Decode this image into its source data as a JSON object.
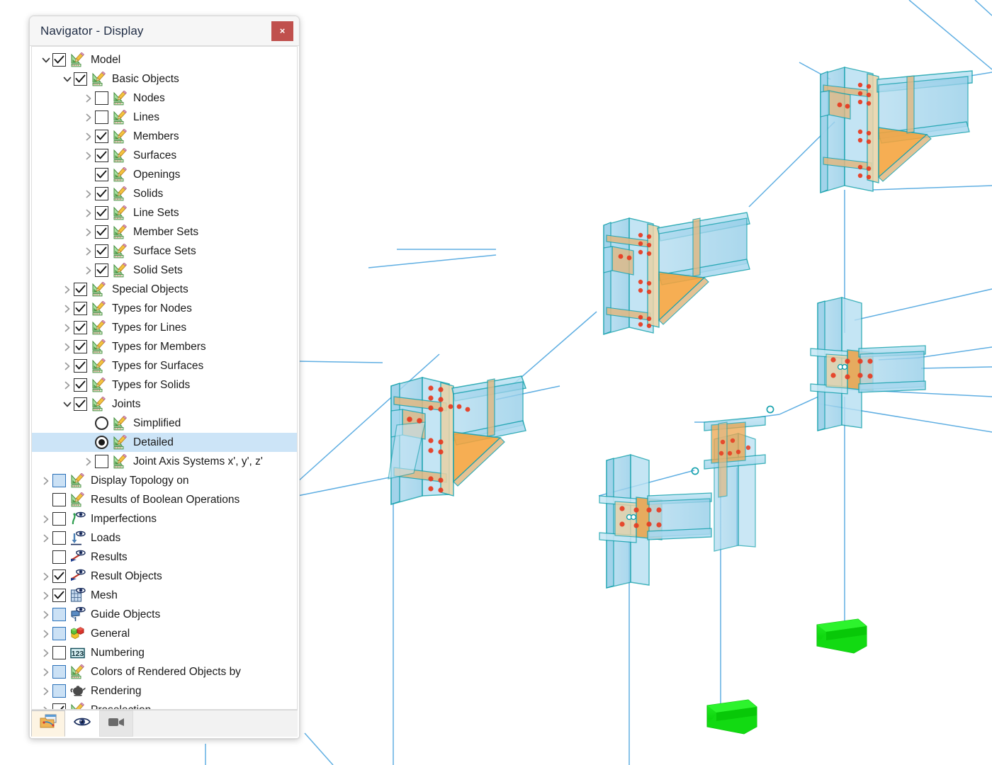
{
  "window": {
    "title": "Navigator - Display",
    "close_label": "×",
    "close_icon": "close-icon",
    "accent_close_color": "#c0504d",
    "selection_color": "#cce4f7"
  },
  "tree": {
    "items": [
      {
        "label": "Model",
        "depth": 0,
        "chev": "down",
        "control": "checkbox",
        "state": "checked",
        "icon": "edit-model-icon"
      },
      {
        "label": "Basic Objects",
        "depth": 1,
        "chev": "down",
        "control": "checkbox",
        "state": "checked",
        "icon": "edit-model-icon"
      },
      {
        "label": "Nodes",
        "depth": 2,
        "chev": "right",
        "control": "checkbox",
        "state": "unchecked",
        "icon": "edit-model-icon"
      },
      {
        "label": "Lines",
        "depth": 2,
        "chev": "right",
        "control": "checkbox",
        "state": "unchecked",
        "icon": "edit-model-icon"
      },
      {
        "label": "Members",
        "depth": 2,
        "chev": "right",
        "control": "checkbox",
        "state": "checked",
        "icon": "edit-model-icon"
      },
      {
        "label": "Surfaces",
        "depth": 2,
        "chev": "right",
        "control": "checkbox",
        "state": "checked",
        "icon": "edit-model-icon"
      },
      {
        "label": "Openings",
        "depth": 2,
        "chev": "none",
        "control": "checkbox",
        "state": "checked",
        "icon": "edit-model-icon"
      },
      {
        "label": "Solids",
        "depth": 2,
        "chev": "right",
        "control": "checkbox",
        "state": "checked",
        "icon": "edit-model-icon"
      },
      {
        "label": "Line Sets",
        "depth": 2,
        "chev": "right",
        "control": "checkbox",
        "state": "checked",
        "icon": "edit-model-icon"
      },
      {
        "label": "Member Sets",
        "depth": 2,
        "chev": "right",
        "control": "checkbox",
        "state": "checked",
        "icon": "edit-model-icon"
      },
      {
        "label": "Surface Sets",
        "depth": 2,
        "chev": "right",
        "control": "checkbox",
        "state": "checked",
        "icon": "edit-model-icon"
      },
      {
        "label": "Solid Sets",
        "depth": 2,
        "chev": "right",
        "control": "checkbox",
        "state": "checked",
        "icon": "edit-model-icon"
      },
      {
        "label": "Special Objects",
        "depth": 1,
        "chev": "right",
        "control": "checkbox",
        "state": "checked",
        "icon": "edit-model-icon"
      },
      {
        "label": "Types for Nodes",
        "depth": 1,
        "chev": "right",
        "control": "checkbox",
        "state": "checked",
        "icon": "edit-model-icon"
      },
      {
        "label": "Types for Lines",
        "depth": 1,
        "chev": "right",
        "control": "checkbox",
        "state": "checked",
        "icon": "edit-model-icon"
      },
      {
        "label": "Types for Members",
        "depth": 1,
        "chev": "right",
        "control": "checkbox",
        "state": "checked",
        "icon": "edit-model-icon"
      },
      {
        "label": "Types for Surfaces",
        "depth": 1,
        "chev": "right",
        "control": "checkbox",
        "state": "checked",
        "icon": "edit-model-icon"
      },
      {
        "label": "Types for Solids",
        "depth": 1,
        "chev": "right",
        "control": "checkbox",
        "state": "checked",
        "icon": "edit-model-icon"
      },
      {
        "label": "Joints",
        "depth": 1,
        "chev": "down",
        "control": "checkbox",
        "state": "checked",
        "icon": "edit-model-icon"
      },
      {
        "label": "Simplified",
        "depth": 2,
        "chev": "none",
        "control": "radio",
        "state": "off",
        "icon": "edit-model-icon"
      },
      {
        "label": "Detailed",
        "depth": 2,
        "chev": "none",
        "control": "radio",
        "state": "on",
        "icon": "edit-model-icon",
        "selected": true
      },
      {
        "label": "Joint Axis Systems x', y', z'",
        "depth": 2,
        "chev": "right",
        "control": "checkbox",
        "state": "unchecked",
        "icon": "edit-model-icon"
      },
      {
        "label": "Display Topology on",
        "depth": 0,
        "chev": "right",
        "control": "checkbox",
        "state": "partial",
        "icon": "edit-model-icon"
      },
      {
        "label": "Results of Boolean Operations",
        "depth": 0,
        "chev": "none",
        "control": "checkbox",
        "state": "unchecked",
        "icon": "edit-model-icon"
      },
      {
        "label": "Imperfections",
        "depth": 0,
        "chev": "right",
        "control": "checkbox",
        "state": "unchecked",
        "icon": "imperfections-eye-icon"
      },
      {
        "label": "Loads",
        "depth": 0,
        "chev": "right",
        "control": "checkbox",
        "state": "unchecked",
        "icon": "loads-eye-icon"
      },
      {
        "label": "Results",
        "depth": 0,
        "chev": "none",
        "control": "checkbox",
        "state": "unchecked",
        "icon": "results-eye-icon"
      },
      {
        "label": "Result Objects",
        "depth": 0,
        "chev": "right",
        "control": "checkbox",
        "state": "checked",
        "icon": "results-eye-icon"
      },
      {
        "label": "Mesh",
        "depth": 0,
        "chev": "right",
        "control": "checkbox",
        "state": "checked",
        "icon": "mesh-grid-eye-icon"
      },
      {
        "label": "Guide Objects",
        "depth": 0,
        "chev": "right",
        "control": "checkbox",
        "state": "partial",
        "icon": "guide-objects-eye-icon"
      },
      {
        "label": "General",
        "depth": 0,
        "chev": "right",
        "control": "checkbox",
        "state": "partial",
        "icon": "colored-cubes-icon"
      },
      {
        "label": "Numbering",
        "depth": 0,
        "chev": "right",
        "control": "checkbox",
        "state": "unchecked",
        "icon": "numbering-123-icon"
      },
      {
        "label": "Colors of Rendered Objects by",
        "depth": 0,
        "chev": "right",
        "control": "checkbox",
        "state": "partial",
        "icon": "edit-model-icon"
      },
      {
        "label": "Rendering",
        "depth": 0,
        "chev": "right",
        "control": "checkbox",
        "state": "partial",
        "icon": "teapot-icon"
      },
      {
        "label": "Preselection",
        "depth": 0,
        "chev": "right",
        "control": "checkbox",
        "state": "checked",
        "icon": "edit-model-icon"
      }
    ]
  },
  "toolbar": {
    "buttons": [
      {
        "name": "display-navigator-tab",
        "icon": "folder-display-icon",
        "state": "active"
      },
      {
        "name": "views-navigator-tab",
        "icon": "eye-icon",
        "state": "lit"
      },
      {
        "name": "camera-navigator-tab",
        "icon": "video-camera-icon",
        "state": "shaded"
      }
    ]
  },
  "viewport": {
    "description": "3D rendered steel frame model with detailed bolted joints",
    "colors": {
      "member_fill": "#a8d8ef",
      "member_edge": "#13a0ac",
      "haunch_fill": "#f5a33c",
      "plate_fill": "#e0b882",
      "bolt_color": "#e8391f",
      "wireframe_line": "#52a8e0",
      "support_green": "#19e019"
    },
    "joints": [
      {
        "name": "joint-top-right",
        "type": "haunched-moment-connection"
      },
      {
        "name": "joint-middle",
        "type": "haunched-moment-connection"
      },
      {
        "name": "joint-left",
        "type": "haunched-moment-connection"
      },
      {
        "name": "joint-right-cross",
        "type": "fin-plate-connection"
      },
      {
        "name": "joint-lower-left",
        "type": "fin-plate-connection"
      },
      {
        "name": "joint-lower-right",
        "type": "splice-connection"
      }
    ],
    "supports": [
      {
        "name": "support-left",
        "kind": "nodal-support"
      },
      {
        "name": "support-right",
        "kind": "nodal-support"
      }
    ]
  }
}
